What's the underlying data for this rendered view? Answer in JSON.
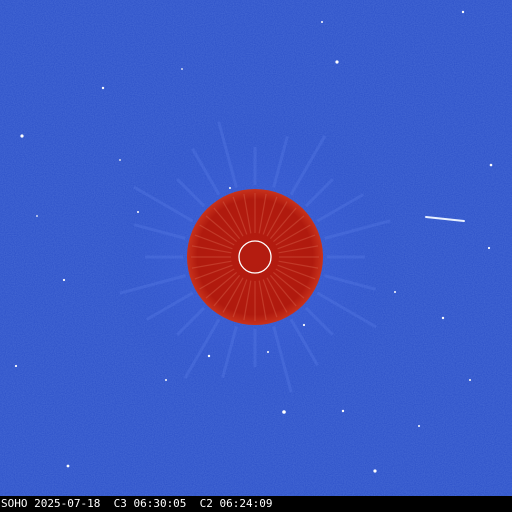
{
  "image": {
    "type": "coronagraph-composite",
    "colors": {
      "sky": "#2b4fc8",
      "occulter": "#b01a0e",
      "occulter_edge": "#c02a18",
      "sun_marker": "#ffffff",
      "caption_bg": "#000000",
      "caption_text": "#ffffff"
    }
  },
  "caption": {
    "text": "SOHO 2025-07-18  C3 06:30:05  C2 06:24:09"
  }
}
